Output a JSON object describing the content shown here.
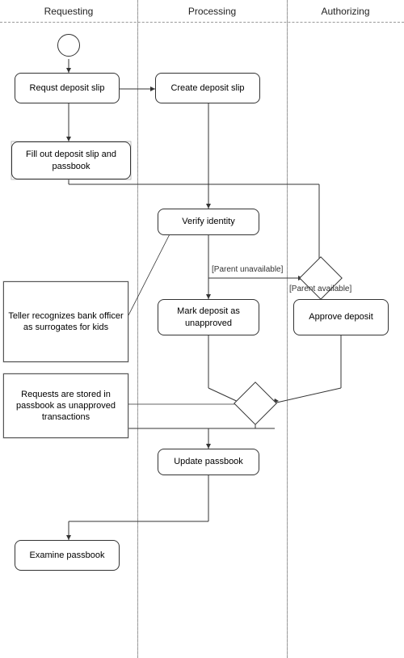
{
  "lanes": {
    "requesting": "Requesting",
    "processing": "Processing",
    "authorizing": "Authorizing"
  },
  "nodes": {
    "start": "●",
    "request_deposit_slip": "Requst deposit slip",
    "create_deposit_slip": "Create deposit slip",
    "fill_out": "Fill out deposit slip and passbook",
    "verify_identity": "Verify identity",
    "teller_recognizes": "Teller recognizes bank officer as surrogates for kids",
    "parent_unavailable_label": "[Parent unavailable]",
    "parent_available_label": "[Parent available]",
    "mark_deposit": "Mark deposit as unapproved",
    "approve_deposit": "Approve deposit",
    "requests_stored": "Requests are stored in passbook as unapproved transactions",
    "update_passbook": "Update passbook",
    "examine_passbook": "Examine passbook"
  }
}
